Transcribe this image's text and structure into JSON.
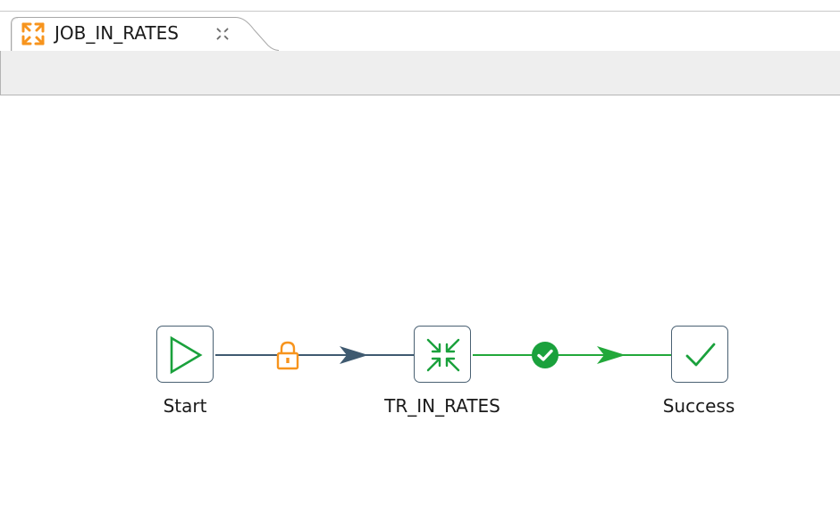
{
  "editor": {
    "tab": {
      "title": "JOB_IN_RATES",
      "icon": "job-icon",
      "close_icon": "close-icon"
    }
  },
  "job": {
    "components": [
      {
        "id": "start",
        "label": "Start",
        "icon": "play-icon"
      },
      {
        "id": "tr_in_rates",
        "label": "TR_IN_RATES",
        "icon": "collapse-arrows-icon"
      },
      {
        "id": "success",
        "label": "Success",
        "icon": "checkmark-icon"
      }
    ],
    "connections": [
      {
        "from": "Start",
        "to": "TR_IN_RATES",
        "type": "lock",
        "icon": "lock-icon"
      },
      {
        "from": "TR_IN_RATES",
        "to": "Success",
        "type": "ok",
        "icon": "ok-check-icon"
      }
    ]
  },
  "colors": {
    "node_border": "#4a6173",
    "start_green": "#1aa13c",
    "link_dark": "#3f5a70",
    "link_green": "#22a83a",
    "lock_orange": "#f7941d",
    "tab_icon_orange": "#f7941d",
    "toolbar_bg": "#eeeeee"
  }
}
